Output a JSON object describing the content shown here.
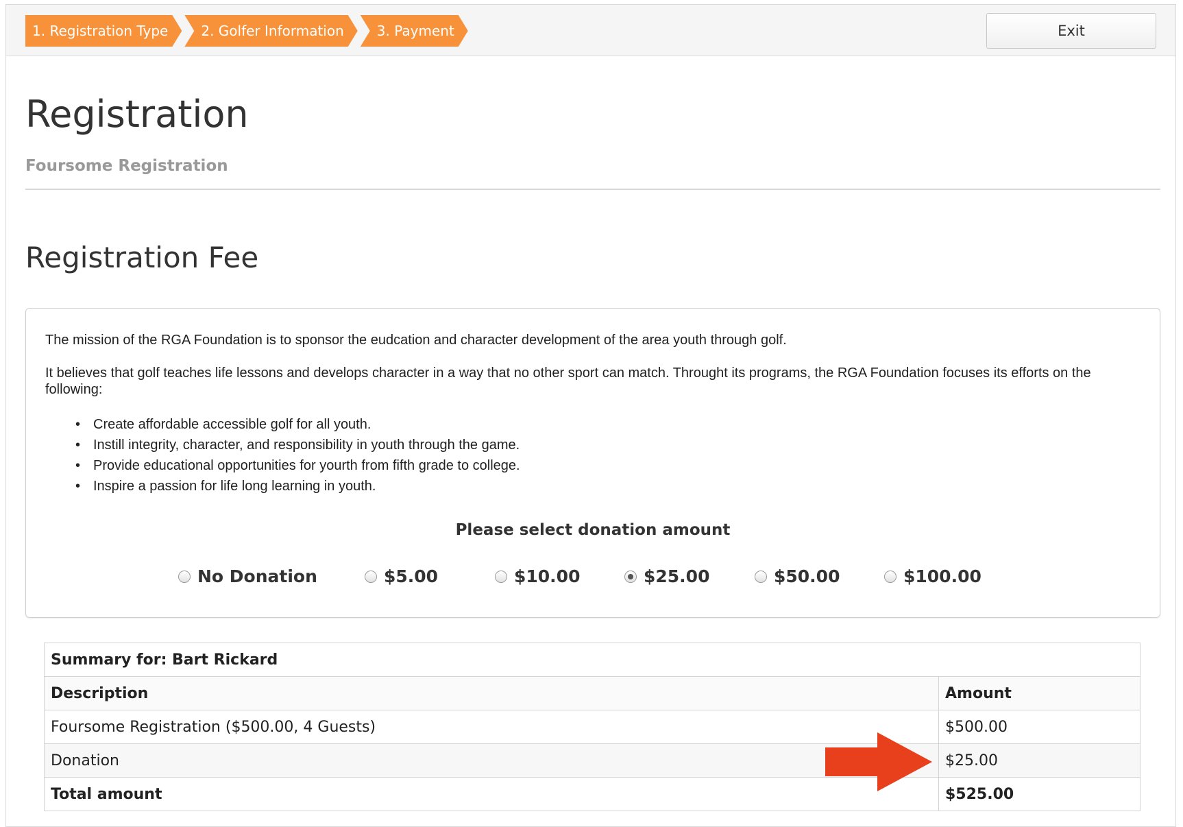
{
  "steps": [
    "1. Registration Type",
    "2. Golfer Information",
    "3. Payment"
  ],
  "exit_label": "Exit",
  "page": {
    "title": "Registration",
    "subtitle": "Foursome Registration",
    "section_title": "Registration Fee"
  },
  "mission": {
    "p1": "The mission of the RGA Foundation is to sponsor the eudcation and character development of the area youth through golf.",
    "p2": "It believes that golf teaches life lessons and develops character in a way that no other sport can match. Throught its programs, the RGA Foundation focuses its efforts on the following:",
    "bullets": [
      "Create affordable accessible golf for all youth.",
      "Instill integrity, character, and responsibility in youth through the game.",
      "Provide educational opportunities for yourth from fifth grade to college.",
      "Inspire a passion for life long learning in youth."
    ]
  },
  "donation": {
    "prompt": "Please select donation amount",
    "options": [
      "No Donation",
      "$5.00",
      "$10.00",
      "$25.00",
      "$50.00",
      "$100.00"
    ],
    "selected": "$25.00"
  },
  "summary": {
    "caption": "Summary for: Bart Rickard",
    "headers": [
      "Description",
      "Amount"
    ],
    "rows": [
      [
        "Foursome Registration ($500.00, 4 Guests)",
        "$500.00"
      ],
      [
        "Donation",
        "$25.00"
      ]
    ],
    "total_label": "Total amount",
    "total_value": "$525.00"
  },
  "colors": {
    "step_bg": "#f7923a",
    "annotation_arrow": "#e8401c"
  }
}
